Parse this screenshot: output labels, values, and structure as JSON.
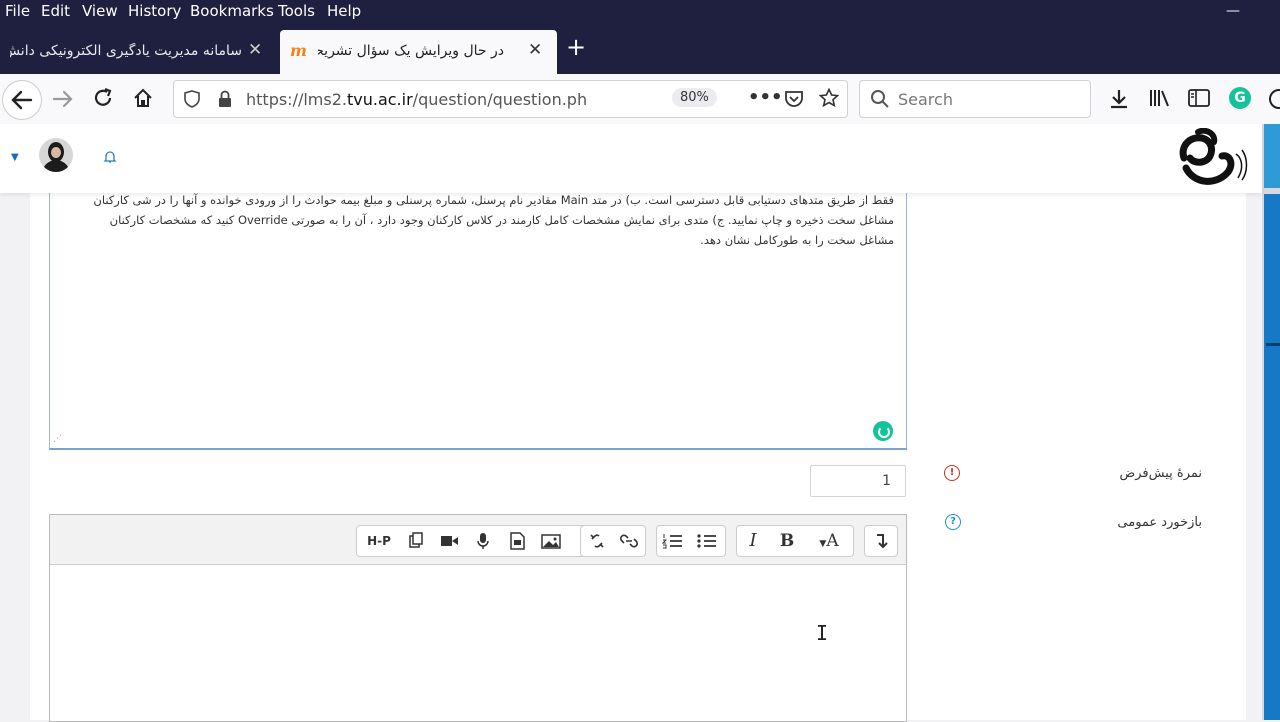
{
  "menu": [
    "File",
    "Edit",
    "View",
    "History",
    "Bookmarks",
    "Tools",
    "Help"
  ],
  "window_controls": {
    "minimize": "—"
  },
  "tabs": [
    {
      "label": "سامانه مدیریت یادگیری الکترونیکی دانش",
      "close": "✕",
      "active": false
    },
    {
      "label": "در حال ویرایش یک سؤال تشریحی",
      "close": "✕",
      "active": true,
      "favicon": "m"
    }
  ],
  "new_tab": "+",
  "nav": {
    "back": "back-arrow-icon",
    "forward": "forward-arrow-icon",
    "reload": "reload-icon",
    "home": "home-icon"
  },
  "url": {
    "prefix": "https://lms2.",
    "domain": "tvu.ac.ir",
    "path": "/question/question.php?courseid=",
    "zoom": "80%"
  },
  "search": {
    "placeholder": "Search"
  },
  "grammarly_letter": "G",
  "site_header": {
    "user": "avatar",
    "notifications": "bell-icon",
    "logo": "university-logo"
  },
  "question_text_lines": [
    "فقط از طریق متدهای دستیابی قابل دسترسی است. ب) در متد Main مقادیر نام پرسنل، شماره پرسنلی و مبلغ بیمه حوادث را از ورودی خوانده و آنها را در شی کارکنان",
    "مشاغل سخت ذخیره و چاپ نمایید. ج) متدی برای نمایش مشخصات کامل کارمند در کلاس کارکنان وجود دارد ، آن را به صورتی Override کنید که مشخصات کارکنان",
    "مشاغل سخت را به طورکامل نشان دهد."
  ],
  "default_mark": {
    "label": "نمرهٔ پیش‌فرض",
    "value": "1",
    "icon": "!"
  },
  "general_feedback": {
    "label": "بازخورد عمومی",
    "icon": "?"
  },
  "toolbar": {
    "h5p": "H-P",
    "bold": "B",
    "italic": "I",
    "font_color": "A"
  },
  "colors": {
    "chrome_dark": "#1f1f3f",
    "moodle_blue": "#0f6cbf",
    "grammarly_green": "#15c39a",
    "required_red": "#ca3120"
  }
}
